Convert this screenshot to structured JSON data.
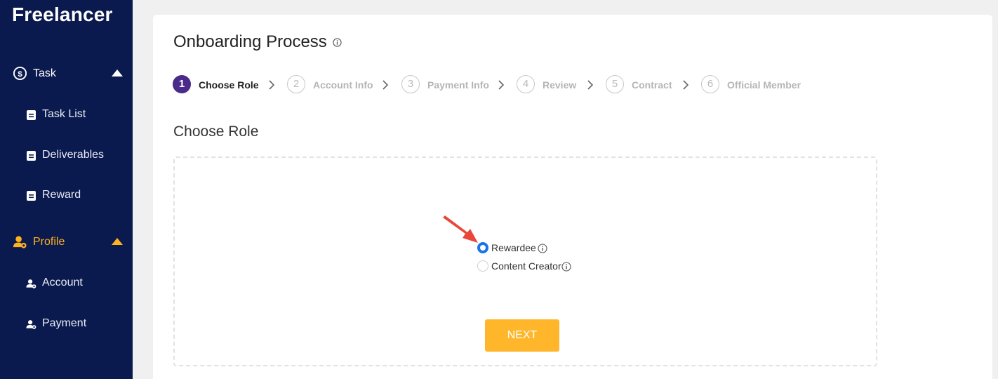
{
  "sidebar": {
    "brand": "Freelancer",
    "groups": [
      {
        "label": "Task",
        "icon": "dollar-circle-icon",
        "items": [
          {
            "label": "Task List",
            "icon": "document-icon"
          },
          {
            "label": "Deliverables",
            "icon": "document-icon"
          },
          {
            "label": "Reward",
            "icon": "document-icon"
          }
        ]
      },
      {
        "label": "Profile",
        "icon": "user-gear-icon",
        "items": [
          {
            "label": "Account",
            "icon": "user-gear-icon"
          },
          {
            "label": "Payment",
            "icon": "user-gear-icon"
          }
        ]
      }
    ],
    "active_color": "#ffb21e",
    "background": "#0b1a4e"
  },
  "main": {
    "title": "Onboarding Process",
    "steps": [
      {
        "number": "1",
        "label": "Choose Role",
        "active": true
      },
      {
        "number": "2",
        "label": "Account Info",
        "active": false
      },
      {
        "number": "3",
        "label": "Payment Info",
        "active": false
      },
      {
        "number": "4",
        "label": "Review",
        "active": false
      },
      {
        "number": "5",
        "label": "Contract",
        "active": false
      },
      {
        "number": "6",
        "label": "Official Member",
        "active": false
      }
    ],
    "section_title": "Choose Role",
    "roles": [
      {
        "label": "Rewardee",
        "checked": true
      },
      {
        "label": "Content Creator",
        "checked": false
      }
    ],
    "next_label": "NEXT",
    "accent_color": "#ffb62a",
    "step_active_color": "#4a2a8a"
  }
}
